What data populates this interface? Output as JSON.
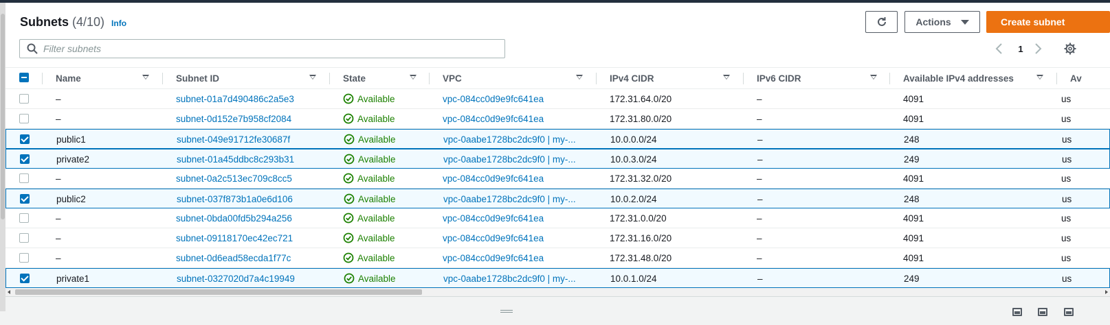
{
  "header": {
    "title": "Subnets",
    "count": "(4/10)",
    "info": "Info"
  },
  "toolbar": {
    "actions_label": "Actions",
    "create_label": "Create subnet"
  },
  "filter": {
    "placeholder": "Filter subnets",
    "value": ""
  },
  "pagination": {
    "current_page": "1"
  },
  "columns": {
    "name": "Name",
    "subnet_id": "Subnet ID",
    "state": "State",
    "vpc": "VPC",
    "ipv4_cidr": "IPv4 CIDR",
    "ipv6_cidr": "IPv6 CIDR",
    "available_ipv4": "Available IPv4 addresses",
    "availability_zone": "Av"
  },
  "rows": [
    {
      "selected": false,
      "name": "–",
      "subnet_id": "subnet-01a7d490486c2a5e3",
      "state": "Available",
      "vpc": "vpc-084cc0d9e9fc641ea",
      "ipv4_cidr": "172.31.64.0/20",
      "ipv6_cidr": "–",
      "available_ipv4": "4091",
      "availability_zone": "us"
    },
    {
      "selected": false,
      "name": "–",
      "subnet_id": "subnet-0d152e7b958cf2084",
      "state": "Available",
      "vpc": "vpc-084cc0d9e9fc641ea",
      "ipv4_cidr": "172.31.80.0/20",
      "ipv6_cidr": "–",
      "available_ipv4": "4091",
      "availability_zone": "us"
    },
    {
      "selected": true,
      "name": "public1",
      "subnet_id": "subnet-049e91712fe30687f",
      "state": "Available",
      "vpc": "vpc-0aabe1728bc2dc9f0 | my-...",
      "ipv4_cidr": "10.0.0.0/24",
      "ipv6_cidr": "–",
      "available_ipv4": "248",
      "availability_zone": "us"
    },
    {
      "selected": true,
      "name": "private2",
      "subnet_id": "subnet-01a45ddbc8c293b31",
      "state": "Available",
      "vpc": "vpc-0aabe1728bc2dc9f0 | my-...",
      "ipv4_cidr": "10.0.3.0/24",
      "ipv6_cidr": "–",
      "available_ipv4": "249",
      "availability_zone": "us"
    },
    {
      "selected": false,
      "name": "–",
      "subnet_id": "subnet-0a2c513ec709c8cc5",
      "state": "Available",
      "vpc": "vpc-084cc0d9e9fc641ea",
      "ipv4_cidr": "172.31.32.0/20",
      "ipv6_cidr": "–",
      "available_ipv4": "4091",
      "availability_zone": "us"
    },
    {
      "selected": true,
      "name": "public2",
      "subnet_id": "subnet-037f873b1a0e6d106",
      "state": "Available",
      "vpc": "vpc-0aabe1728bc2dc9f0 | my-...",
      "ipv4_cidr": "10.0.2.0/24",
      "ipv6_cidr": "–",
      "available_ipv4": "248",
      "availability_zone": "us"
    },
    {
      "selected": false,
      "name": "–",
      "subnet_id": "subnet-0bda00fd5b294a256",
      "state": "Available",
      "vpc": "vpc-084cc0d9e9fc641ea",
      "ipv4_cidr": "172.31.0.0/20",
      "ipv6_cidr": "–",
      "available_ipv4": "4091",
      "availability_zone": "us"
    },
    {
      "selected": false,
      "name": "–",
      "subnet_id": "subnet-09118170ec42ec721",
      "state": "Available",
      "vpc": "vpc-084cc0d9e9fc641ea",
      "ipv4_cidr": "172.31.16.0/20",
      "ipv6_cidr": "–",
      "available_ipv4": "4091",
      "availability_zone": "us"
    },
    {
      "selected": false,
      "name": "–",
      "subnet_id": "subnet-0d6ead58ecda1f77c",
      "state": "Available",
      "vpc": "vpc-084cc0d9e9fc641ea",
      "ipv4_cidr": "172.31.48.0/20",
      "ipv6_cidr": "–",
      "available_ipv4": "4091",
      "availability_zone": "us"
    },
    {
      "selected": true,
      "name": "private1",
      "subnet_id": "subnet-0327020d7a4c19949",
      "state": "Available",
      "vpc": "vpc-0aabe1728bc2dc9f0 | my-...",
      "ipv4_cidr": "10.0.1.0/24",
      "ipv6_cidr": "–",
      "available_ipv4": "249",
      "availability_zone": "us"
    }
  ],
  "icons": {
    "refresh": "refresh-icon",
    "search": "search-icon",
    "settings": "gear-icon",
    "status_ok": "check-circle-icon"
  },
  "colors": {
    "accent": "#0073bb",
    "primary_button": "#ec7211",
    "success": "#1d8102"
  }
}
